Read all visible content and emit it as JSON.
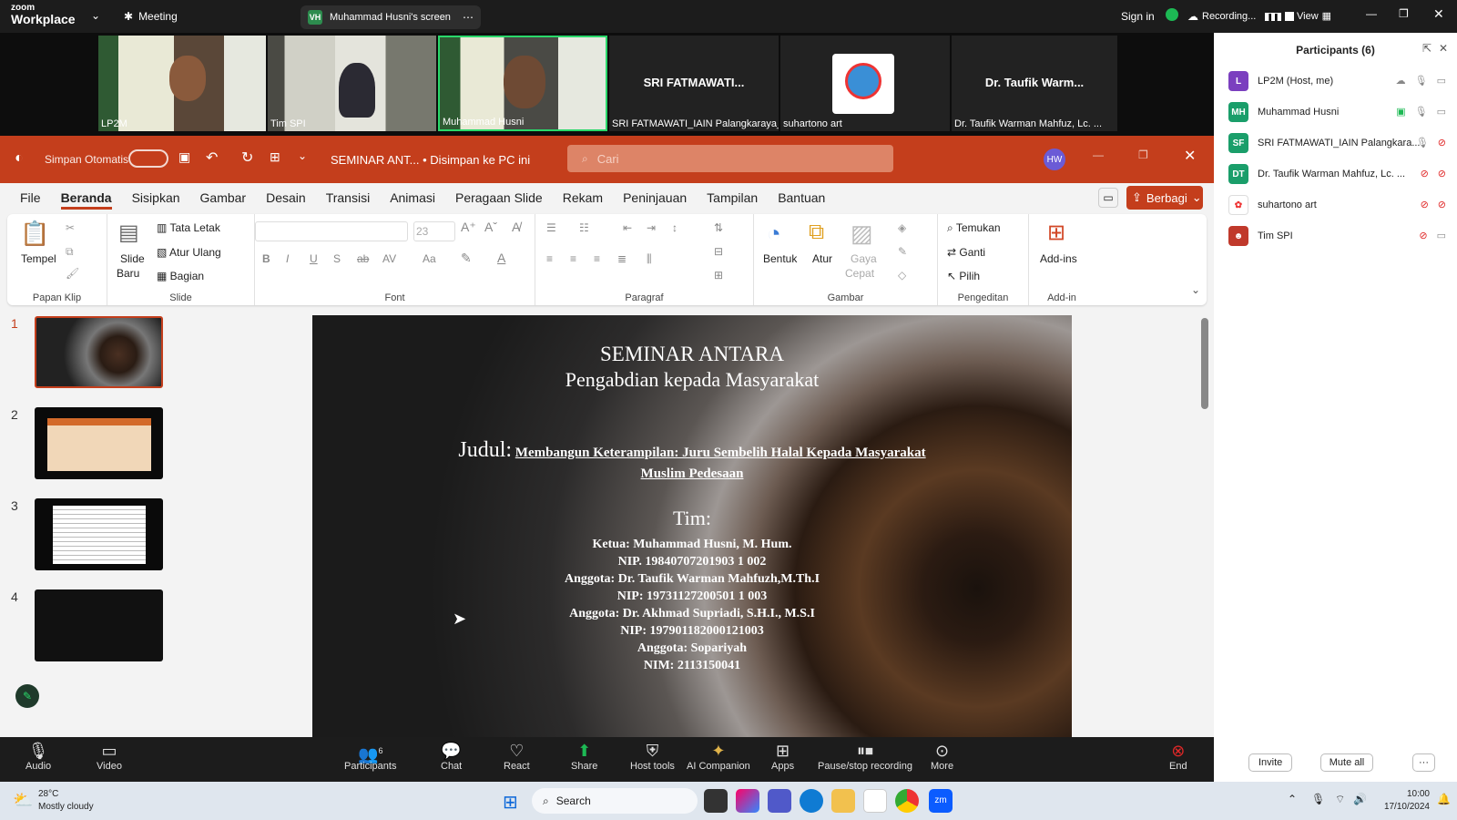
{
  "zoom_top": {
    "logo_small": "zoom",
    "logo_big": "Workplace",
    "meeting": "Meeting",
    "share_initials": "VH",
    "share_label": "Muhammad Husni's screen",
    "sign_in": "Sign in",
    "recording": "Recording...",
    "view": "View"
  },
  "video_tiles": [
    {
      "name": "LP2M"
    },
    {
      "name": "Tim SPI"
    },
    {
      "name": "Muhammad Husni"
    },
    {
      "name": "SRI FATMAWATI_IAIN Palangkaraya_I...",
      "big": "SRI FATMAWATI..."
    },
    {
      "name": "suhartono art"
    },
    {
      "name": "Dr. Taufik Warman Mahfuz, Lc. ...",
      "big": "Dr. Taufik Warm..."
    }
  ],
  "participants": {
    "title": "Participants (6)",
    "list": [
      {
        "initials": "L",
        "name": "LP2M (Host, me)",
        "color": "#7b3fbf"
      },
      {
        "initials": "MH",
        "name": "Muhammad Husni",
        "color": "#1a9e6a"
      },
      {
        "initials": "SF",
        "name": "SRI FATMAWATI_IAIN Palangkara...",
        "color": "#1a9e6a"
      },
      {
        "initials": "DT",
        "name": "Dr. Taufik Warman Mahfuz, Lc. ...",
        "color": "#1a9e6a"
      },
      {
        "initials": "",
        "name": "suhartono art",
        "color": "#ffffff"
      },
      {
        "initials": "",
        "name": "Tim SPI",
        "color": "#c0392b"
      }
    ],
    "invite": "Invite",
    "mute_all": "Mute all",
    "more": "···"
  },
  "ppt": {
    "autosave": "Simpan Otomatis",
    "doc_title": "SEMINAR ANT... • Disimpan ke PC ini",
    "search_placeholder": "Cari",
    "user_initials": "HW",
    "share_button": "Berbagi",
    "tabs": [
      "File",
      "Beranda",
      "Sisipkan",
      "Gambar",
      "Desain",
      "Transisi",
      "Animasi",
      "Peragaan Slide",
      "Rekam",
      "Peninjauan",
      "Tampilan",
      "Bantuan"
    ],
    "active_tab": "Beranda",
    "ribbon": {
      "paste": "Tempel",
      "clipboard": "Papan Klip",
      "new_slide_1": "Slide",
      "new_slide_2": "Baru",
      "layout": "Tata Letak",
      "reset": "Atur Ulang",
      "section": "Bagian",
      "slide_group": "Slide",
      "font_size": "23",
      "font_group": "Font",
      "paragraph_group": "Paragraf",
      "shapes": "Bentuk",
      "arrange": "Atur",
      "quick_styles_1": "Gaya",
      "quick_styles_2": "Cepat",
      "drawing_group": "Gambar",
      "find": "Temukan",
      "replace": "Ganti",
      "select": "Pilih",
      "editing_group": "Pengeditan",
      "addins": "Add-ins",
      "addins_group": "Add-in"
    },
    "thumbnails": [
      "1",
      "2",
      "3",
      "4"
    ]
  },
  "slide": {
    "title1": "SEMINAR ANTARA",
    "title2": "Pengabdian kepada Masyarakat",
    "judul_label": "Judul:",
    "judul_text": "Membangun Keterampilan: Juru Sembelih Halal Kepada Masyarakat",
    "judul_text2": "Muslim Pedesaan",
    "tim": "Tim:",
    "lines": [
      "Ketua: Muhammad Husni, M. Hum.",
      "NIP. 19840707201903 1 002",
      "Anggota: Dr. Taufik Warman Mahfuzh,M.Th.I",
      "NIP: 19731127200501 1 003",
      "Anggota: Dr. Akhmad Supriadi, S.H.I., M.S.I",
      "NIP: 197901182000121003",
      "Anggota: Sopariyah",
      "NIM: 2113150041"
    ]
  },
  "zoom_bottom": {
    "audio": "Audio",
    "video": "Video",
    "participants": "Participants",
    "participants_count": "6",
    "chat": "Chat",
    "react": "React",
    "share": "Share",
    "host_tools": "Host tools",
    "ai_companion": "AI Companion",
    "apps": "Apps",
    "pause_stop": "Pause/stop recording",
    "more": "More",
    "end": "End"
  },
  "taskbar": {
    "temp": "28°C",
    "weather": "Mostly cloudy",
    "search": "Search",
    "time": "10:00",
    "date": "17/10/2024"
  },
  "colors": {
    "ppt_red": "#c43e1c",
    "zoom_dark": "#1c1c1c",
    "share_green": "#1db954",
    "end_red": "#e02828"
  }
}
